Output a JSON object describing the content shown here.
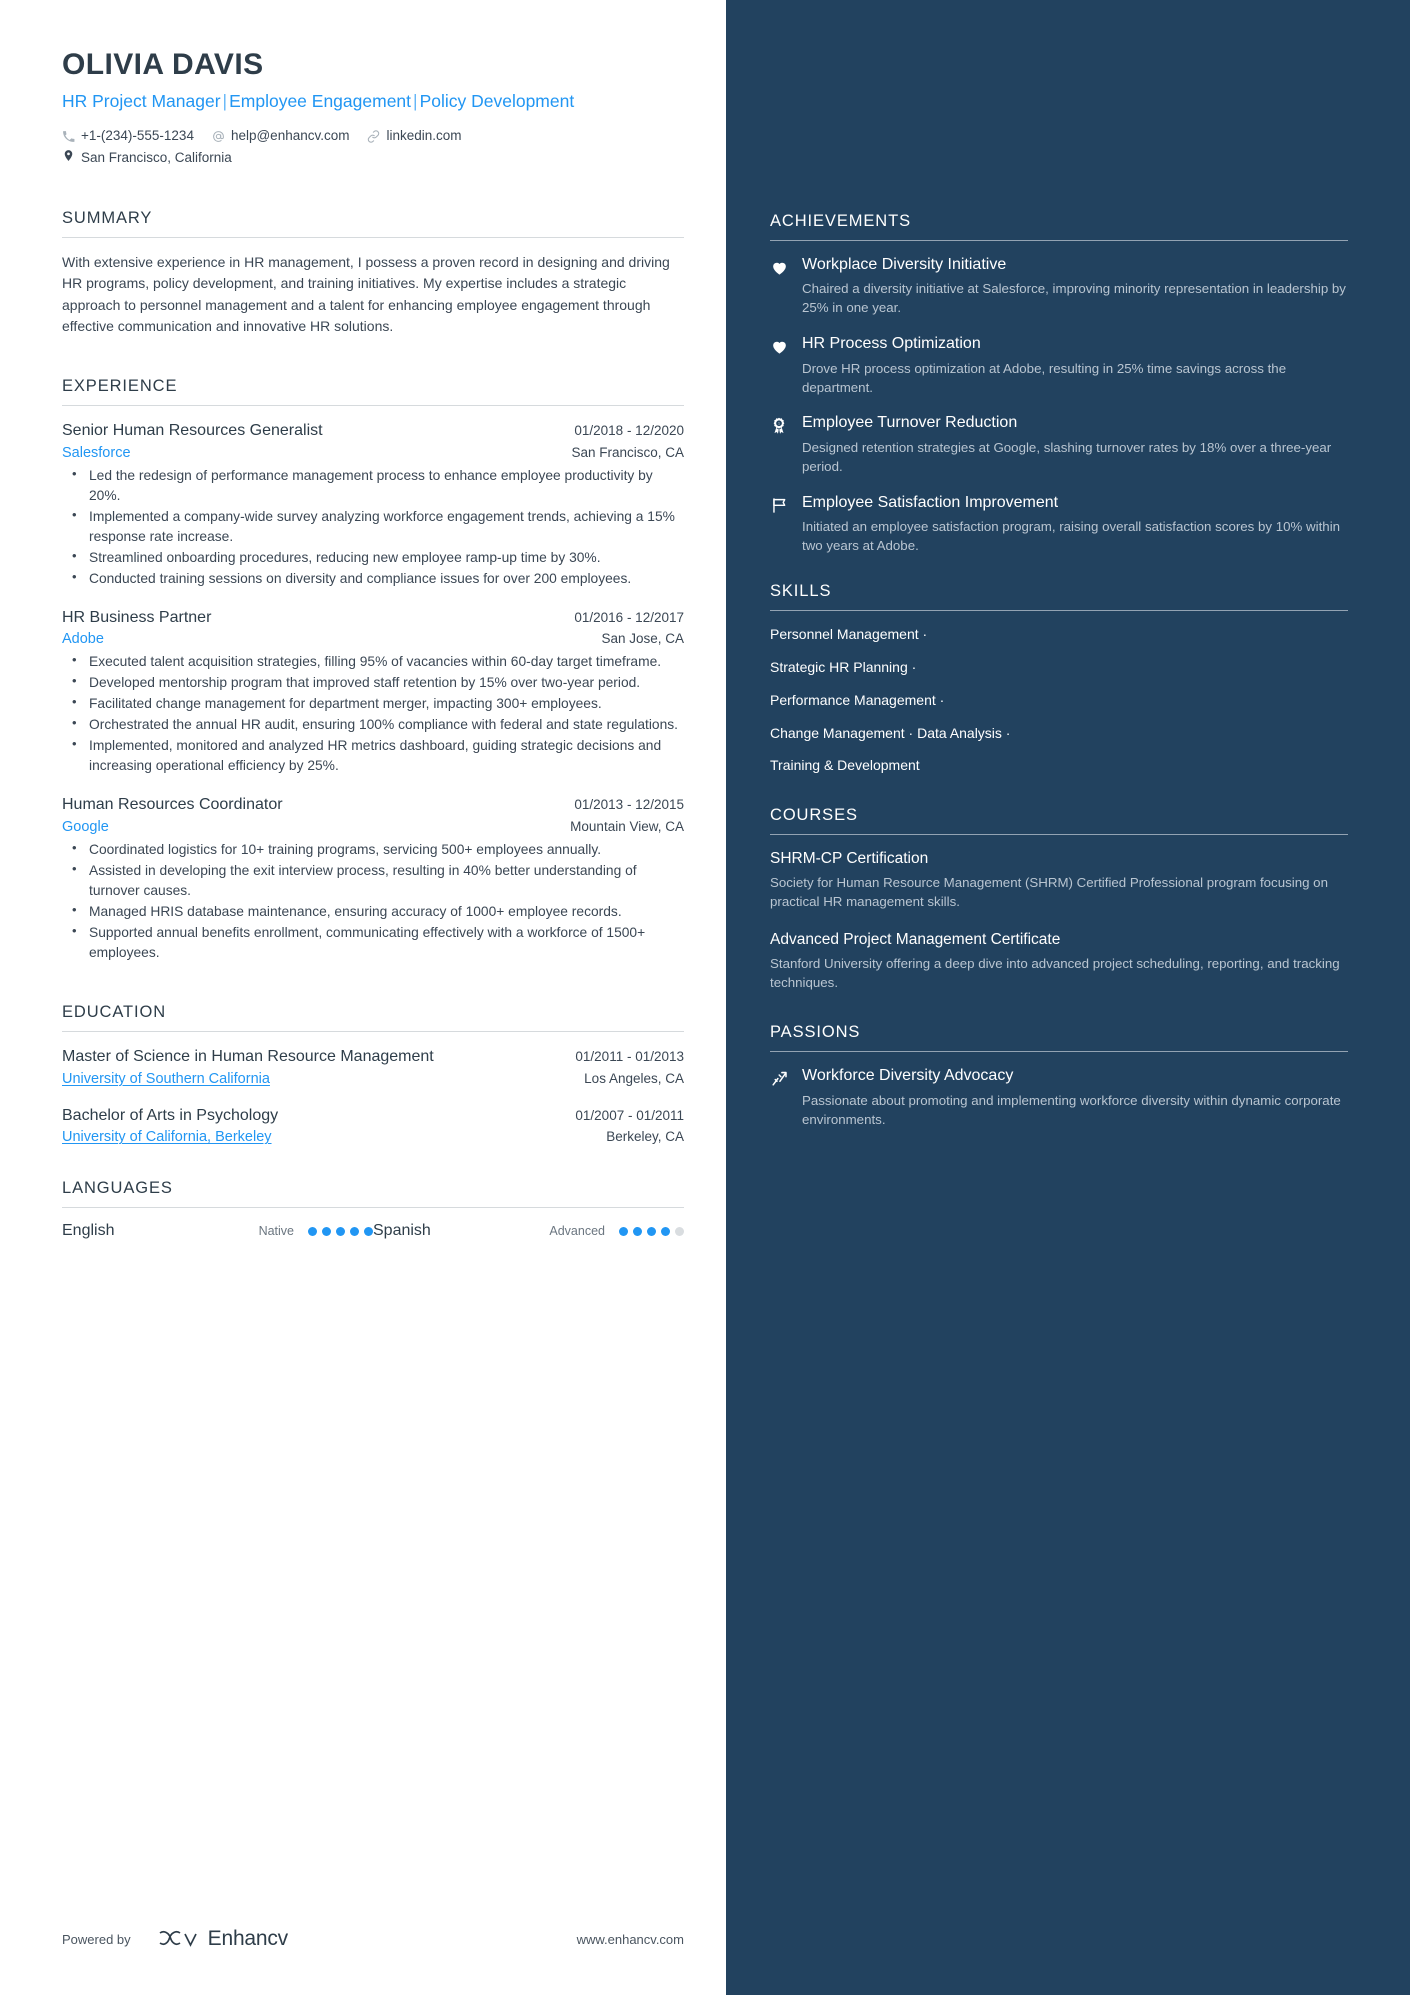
{
  "header": {
    "name": "OLIVIA DAVIS",
    "headline_parts": [
      "HR Project Manager",
      "Employee Engagement",
      "Policy Development"
    ],
    "headline_separator": "|",
    "contact": {
      "phone": "+1-(234)-555-1234",
      "email": "help@enhancv.com",
      "link": "linkedin.com",
      "location": "San Francisco, California"
    }
  },
  "sections": {
    "summary_title": "SUMMARY",
    "summary_text": "With extensive experience in HR management, I possess a proven record in designing and driving HR programs, policy development, and training initiatives. My expertise includes a strategic approach to personnel management and a talent for enhancing employee engagement through effective communication and innovative HR solutions.",
    "experience_title": "EXPERIENCE",
    "education_title": "EDUCATION",
    "languages_title": "LANGUAGES"
  },
  "experience": [
    {
      "title": "Senior Human Resources Generalist",
      "dates": "01/2018 - 12/2020",
      "company": "Salesforce",
      "location": "San Francisco, CA",
      "bullets": [
        "Led the redesign of performance management process to enhance employee productivity by 20%.",
        "Implemented a company-wide survey analyzing workforce engagement trends, achieving a 15% response rate increase.",
        "Streamlined onboarding procedures, reducing new employee ramp-up time by 30%.",
        "Conducted training sessions on diversity and compliance issues for over 200 employees."
      ]
    },
    {
      "title": "HR Business Partner",
      "dates": "01/2016 - 12/2017",
      "company": "Adobe",
      "location": "San Jose, CA",
      "bullets": [
        "Executed talent acquisition strategies, filling 95% of vacancies within 60-day target timeframe.",
        "Developed mentorship program that improved staff retention by 15% over two-year period.",
        "Facilitated change management for department merger, impacting 300+ employees.",
        "Orchestrated the annual HR audit, ensuring 100% compliance with federal and state regulations.",
        "Implemented, monitored and analyzed HR metrics dashboard, guiding strategic decisions and increasing operational efficiency by 25%."
      ]
    },
    {
      "title": "Human Resources Coordinator",
      "dates": "01/2013 - 12/2015",
      "company": "Google",
      "location": "Mountain View, CA",
      "bullets": [
        "Coordinated logistics for 10+ training programs, servicing 500+ employees annually.",
        "Assisted in developing the exit interview process, resulting in 40% better understanding of turnover causes.",
        "Managed HRIS database maintenance, ensuring accuracy of 1000+ employee records.",
        "Supported annual benefits enrollment, communicating effectively with a workforce of 1500+ employees."
      ]
    }
  ],
  "education": [
    {
      "degree": "Master of Science in Human Resource Management",
      "dates": "01/2011 - 01/2013",
      "school": "University of Southern California",
      "location": "Los Angeles, CA"
    },
    {
      "degree": "Bachelor of Arts in Psychology",
      "dates": "01/2007 - 01/2011",
      "school": "University of California, Berkeley",
      "location": "Berkeley, CA"
    }
  ],
  "languages": [
    {
      "name": "English",
      "level": "Native",
      "filled": 5,
      "total": 5
    },
    {
      "name": "Spanish",
      "level": "Advanced",
      "filled": 4,
      "total": 5
    }
  ],
  "footer": {
    "powered_by": "Powered by",
    "brand": "Enhancv",
    "site": "www.enhancv.com"
  },
  "sidebar": {
    "achievements_title": "ACHIEVEMENTS",
    "achievements": [
      {
        "icon": "heart-icon",
        "title": "Workplace Diversity Initiative",
        "desc": "Chaired a diversity initiative at Salesforce, improving minority representation in leadership by 25% in one year."
      },
      {
        "icon": "heart-icon",
        "title": "HR Process Optimization",
        "desc": "Drove HR process optimization at Adobe, resulting in 25% time savings across the department."
      },
      {
        "icon": "award-ribbon-icon",
        "title": "Employee Turnover Reduction",
        "desc": "Designed retention strategies at Google, slashing turnover rates by 18% over a three-year period."
      },
      {
        "icon": "flag-icon",
        "title": "Employee Satisfaction Improvement",
        "desc": "Initiated an employee satisfaction program, raising overall satisfaction scores by 10% within two years at Adobe."
      }
    ],
    "skills_title": "SKILLS",
    "skills_lines": [
      "Personnel Management ·",
      "Strategic HR Planning ·",
      "Performance Management ·",
      "Change Management · Data Analysis ·",
      "Training & Development"
    ],
    "courses_title": "COURSES",
    "courses": [
      {
        "title": "SHRM-CP Certification",
        "desc": "Society for Human Resource Management (SHRM) Certified Professional program focusing on practical HR management skills."
      },
      {
        "title": "Advanced Project Management Certificate",
        "desc": "Stanford University offering a deep dive into advanced project scheduling, reporting, and tracking techniques."
      }
    ],
    "passions_title": "PASSIONS",
    "passions": [
      {
        "icon": "growth-arrow-icon",
        "title": "Workforce Diversity Advocacy",
        "desc": "Passionate about promoting and implementing workforce diversity within dynamic corporate environments."
      }
    ]
  },
  "colors": {
    "accent_blue": "#2196f3",
    "sidebar_bg": "#22425f",
    "text_dark": "#2e3d49",
    "text_body": "#3b4754",
    "muted_light": "#b9c5d1"
  }
}
